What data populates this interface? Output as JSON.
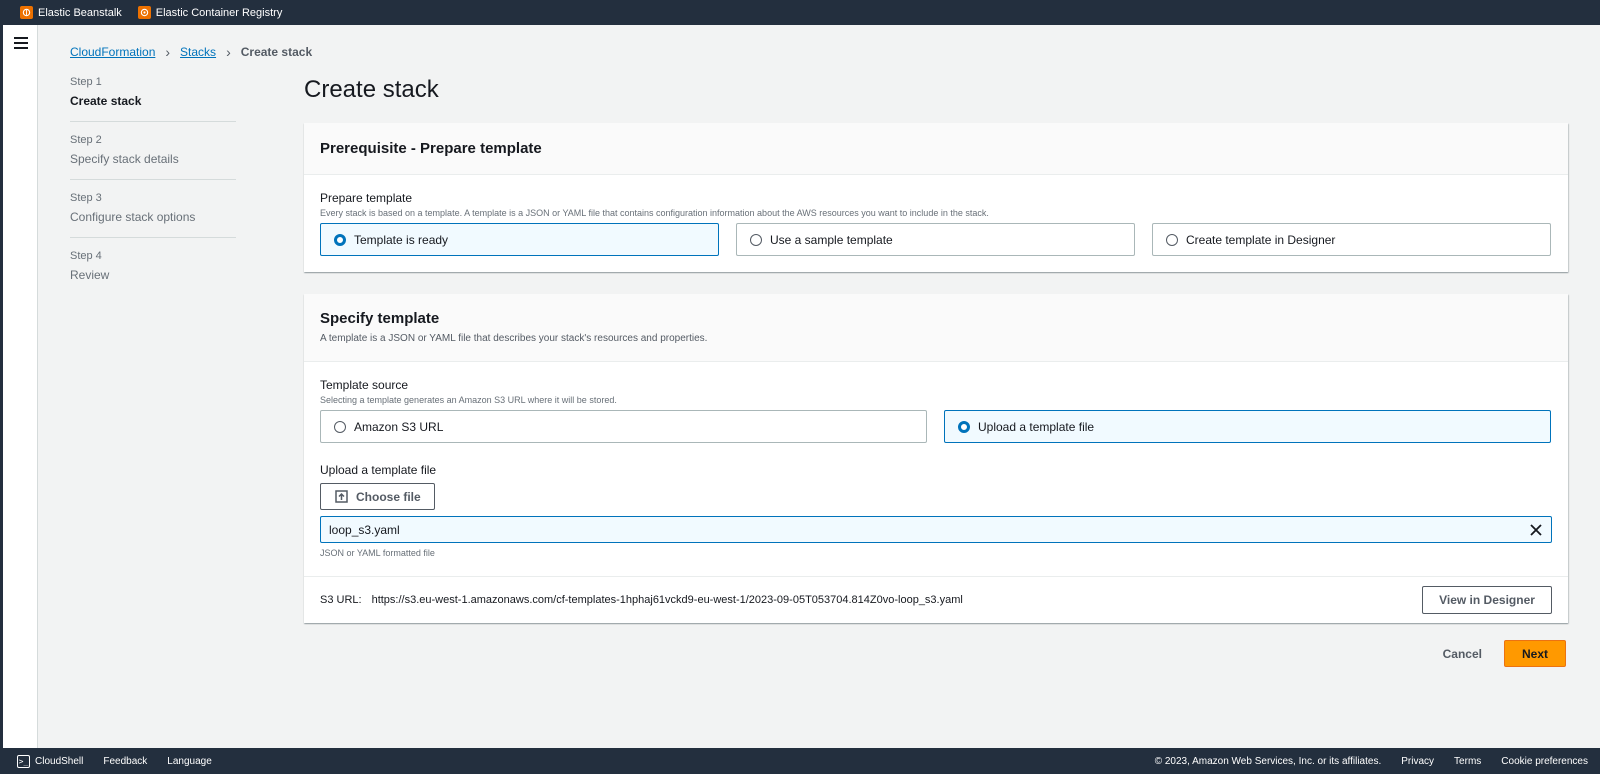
{
  "topbar": {
    "favorites": [
      {
        "label": "Elastic Beanstalk",
        "icon": "beanstalk-icon"
      },
      {
        "label": "Elastic Container Registry",
        "icon": "ecr-icon"
      }
    ]
  },
  "breadcrumb": {
    "items": [
      "CloudFormation",
      "Stacks"
    ],
    "current": "Create stack"
  },
  "steps": [
    {
      "num": "Step 1",
      "label": "Create stack",
      "active": true
    },
    {
      "num": "Step 2",
      "label": "Specify stack details",
      "active": false
    },
    {
      "num": "Step 3",
      "label": "Configure stack options",
      "active": false
    },
    {
      "num": "Step 4",
      "label": "Review",
      "active": false
    }
  ],
  "page_title": "Create stack",
  "prepare": {
    "title": "Prerequisite - Prepare template",
    "field_label": "Prepare template",
    "field_desc": "Every stack is based on a template. A template is a JSON or YAML file that contains configuration information about the AWS resources you want to include in the stack.",
    "options": [
      {
        "label": "Template is ready",
        "selected": true
      },
      {
        "label": "Use a sample template",
        "selected": false
      },
      {
        "label": "Create template in Designer",
        "selected": false
      }
    ]
  },
  "specify": {
    "title": "Specify template",
    "desc": "A template is a JSON or YAML file that describes your stack's resources and properties.",
    "source_label": "Template source",
    "source_desc": "Selecting a template generates an Amazon S3 URL where it will be stored.",
    "sources": [
      {
        "label": "Amazon S3 URL",
        "selected": false
      },
      {
        "label": "Upload a template file",
        "selected": true
      }
    ],
    "upload_label": "Upload a template file",
    "choose_file": "Choose file",
    "file_name": "loop_s3.yaml",
    "file_hint": "JSON or YAML formatted file",
    "s3_label": "S3 URL:",
    "s3_url": "https://s3.eu-west-1.amazonaws.com/cf-templates-1hphaj61vckd9-eu-west-1/2023-09-05T053704.814Z0vo-loop_s3.yaml",
    "view_designer": "View in Designer"
  },
  "actions": {
    "cancel": "Cancel",
    "next": "Next"
  },
  "footer": {
    "cloudshell": "CloudShell",
    "feedback": "Feedback",
    "language": "Language",
    "copyright": "© 2023, Amazon Web Services, Inc. or its affiliates.",
    "privacy": "Privacy",
    "terms": "Terms",
    "cookies": "Cookie preferences"
  },
  "colors": {
    "accent": "#0073bb",
    "primary_button": "#ff9900",
    "topbar": "#232f3e"
  }
}
